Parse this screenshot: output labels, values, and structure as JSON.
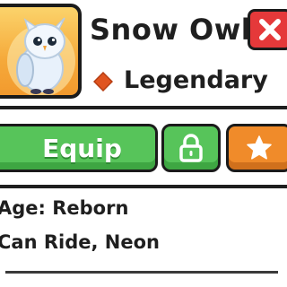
{
  "pet": {
    "name": "Snow Owl",
    "rarity": "Legendary",
    "rarity_color": "#e0541f"
  },
  "actions": {
    "equip_label": "Equip"
  },
  "details": {
    "age": "Age: Reborn",
    "traits": "Can Ride, Neon"
  },
  "icons": [
    "snow-owl-icon",
    "close-icon",
    "rarity-diamond-icon",
    "lock-icon",
    "star-icon"
  ],
  "colors": {
    "close": "#e5393a",
    "equip": "#57c45a",
    "favorite": "#f08b2a",
    "portrait_bg": "#f5a93a"
  }
}
